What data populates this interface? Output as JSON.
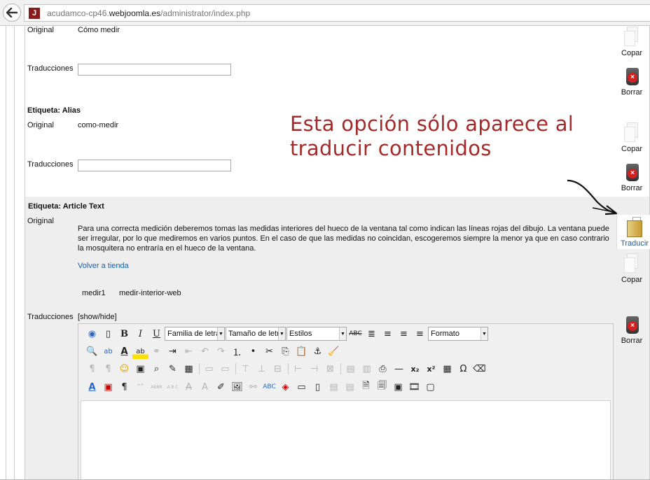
{
  "browser": {
    "url_prefix": "acudamco-cp46.",
    "url_domain": "webjoomla.es",
    "url_path": "/administrator/index.php",
    "favicon_label": "J"
  },
  "fields": {
    "original_label": "Original",
    "translations_label": "Traducciones",
    "original_title": "Cómo medir",
    "alias_heading": "Etiqueta: Alias",
    "original_alias": "como-medir",
    "article_heading": "Etiqueta: Article Text",
    "article_text": "Para una correcta medición deberemos tomas las medidas interiores del hueco de la ventana tal como indican las líneas rojas del dibujo. La ventana puede ser irregular, por lo que mediremos en varios puntos. En el caso de que las medidas no coincidan, escogeremos siempre la menor ya que en caso contrario la mosquitera no entraría en el hueco de la ventana.",
    "back_link": "Volver a tienda",
    "tag1": "medir1",
    "tag2": "medir-interior-web",
    "show_hide": "[show/hide]"
  },
  "annotation": {
    "line1": "Esta opción sólo aparece al",
    "line2": "traducir contenidos"
  },
  "actions": {
    "copy": "Copar",
    "delete": "Borrar",
    "translate": "Traducir"
  },
  "editor": {
    "font_family": "Familia de letra",
    "font_size": "Tamaño de letra",
    "styles": "Estilos",
    "format": "Formato"
  }
}
